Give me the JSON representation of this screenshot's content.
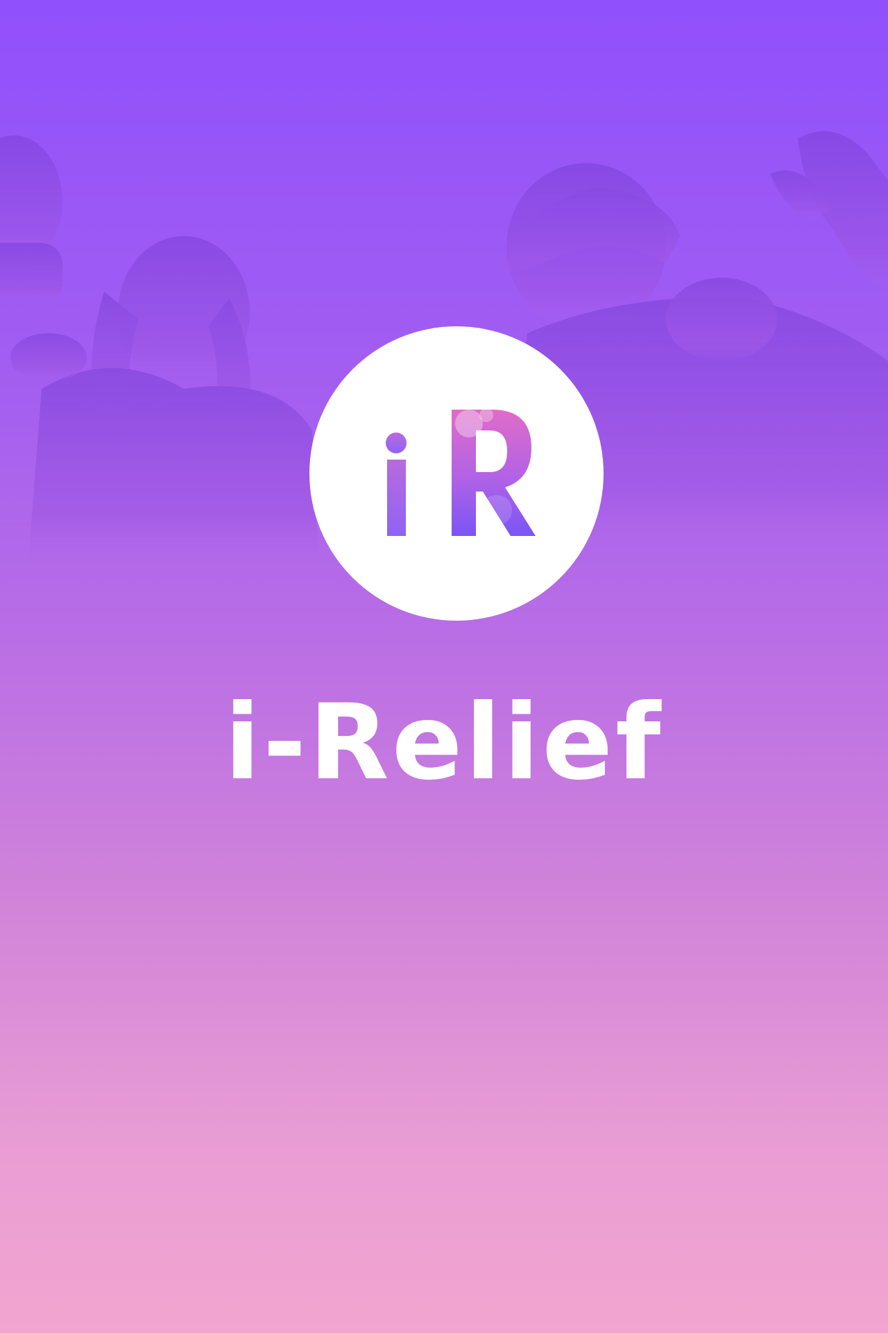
{
  "app": {
    "name": "i-Relief"
  },
  "logo": {
    "monogram": "iR",
    "icon": "ir-monogram-icon"
  },
  "background": {
    "icon": "group-of-people-photo",
    "colors": {
      "top": "#9050fc",
      "middle": "#bc70e4",
      "bottom": "#f2a5d0"
    }
  },
  "colors": {
    "logo_background": "#ffffff",
    "logo_letter_top": "#e06cc8",
    "logo_letter_bottom": "#7a55f5",
    "title_text": "#ffffff"
  }
}
